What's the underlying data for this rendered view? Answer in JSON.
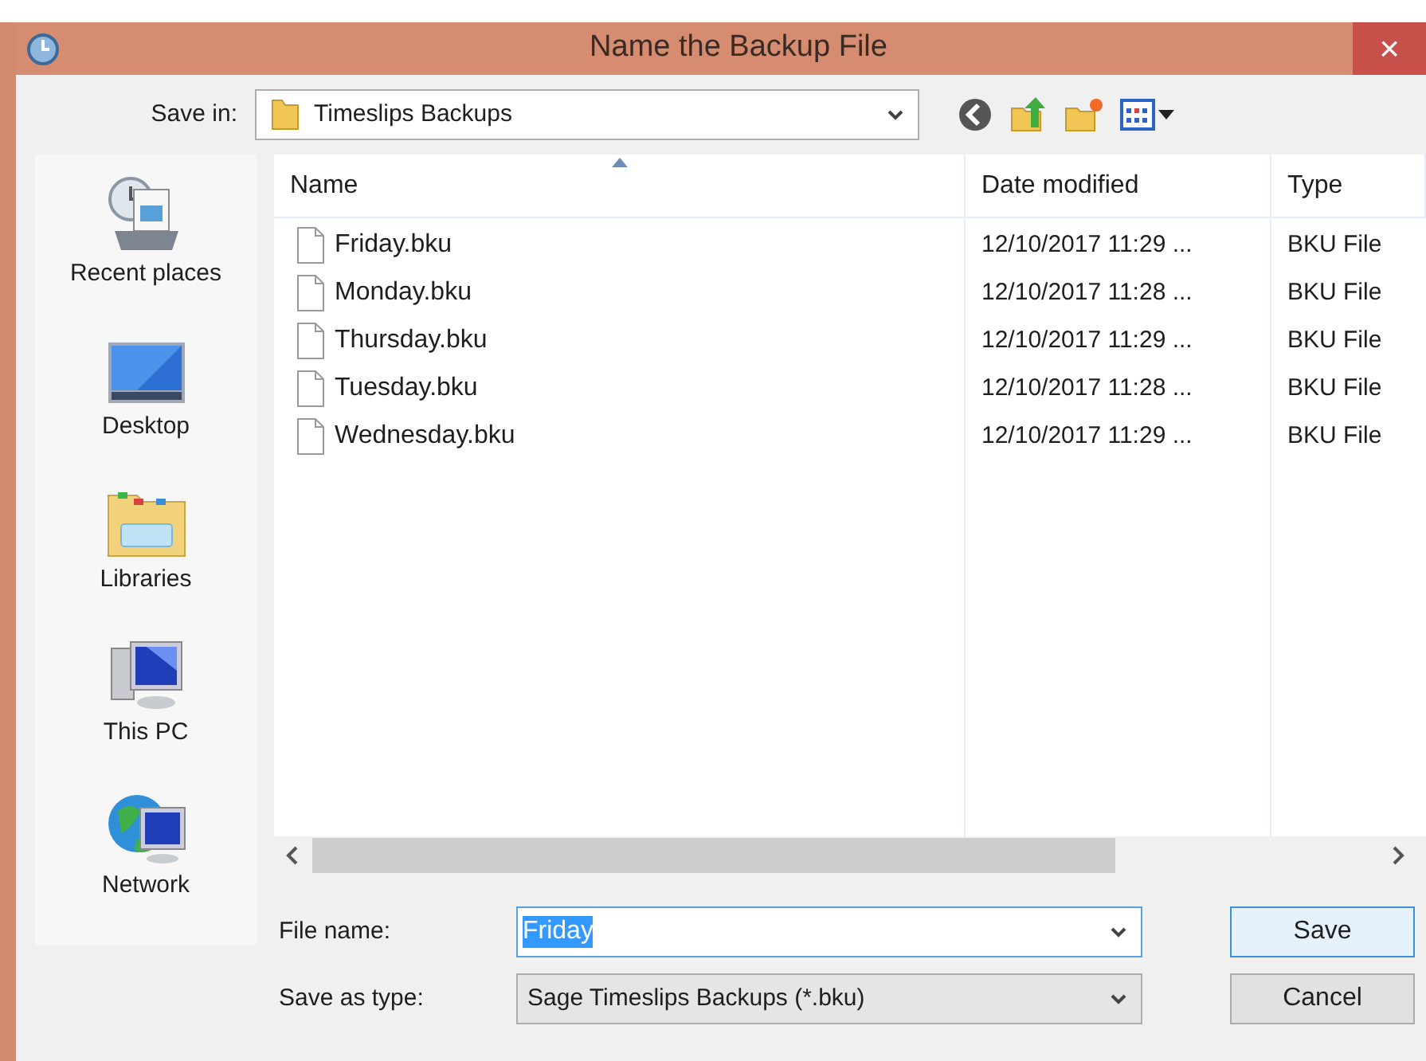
{
  "window": {
    "title": "Name the Backup File",
    "close": "×"
  },
  "save_in": {
    "label": "Save in:",
    "value": "Timeslips Backups"
  },
  "sidebar": {
    "items": [
      {
        "label": "Recent places",
        "kind": "recent"
      },
      {
        "label": "Desktop",
        "kind": "desktop"
      },
      {
        "label": "Libraries",
        "kind": "libraries"
      },
      {
        "label": "This PC",
        "kind": "computer"
      },
      {
        "label": "Network",
        "kind": "network"
      }
    ]
  },
  "table": {
    "columns": [
      {
        "label": "Name",
        "sorted": true
      },
      {
        "label": "Date modified",
        "sorted": false
      },
      {
        "label": "Type",
        "sorted": false
      }
    ],
    "rows": [
      {
        "name": "Friday.bku",
        "date": "12/10/2017 11:29 ...",
        "type": "BKU File"
      },
      {
        "name": "Monday.bku",
        "date": "12/10/2017 11:28 ...",
        "type": "BKU File"
      },
      {
        "name": "Thursday.bku",
        "date": "12/10/2017 11:29 ...",
        "type": "BKU File"
      },
      {
        "name": "Tuesday.bku",
        "date": "12/10/2017 11:28 ...",
        "type": "BKU File"
      },
      {
        "name": "Wednesday.bku",
        "date": "12/10/2017 11:29 ...",
        "type": "BKU File"
      }
    ]
  },
  "file_name": {
    "label": "File name:",
    "value": "Friday",
    "value_selected": true
  },
  "save_as_type": {
    "label": "Save as type:",
    "value": "Sage Timeslips Backups (*.bku)"
  },
  "buttons": [
    {
      "label": "Save",
      "default": true
    },
    {
      "label": "Cancel",
      "default": false
    }
  ]
}
